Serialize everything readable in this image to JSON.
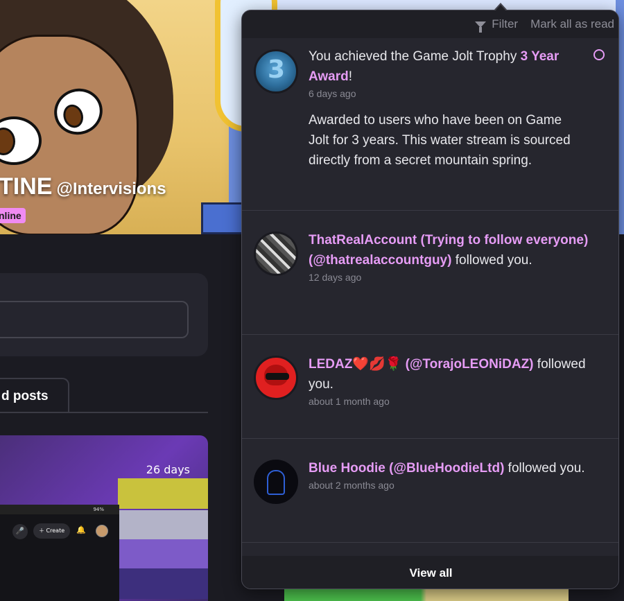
{
  "profile": {
    "name_fragment": "TINE",
    "handle": "@Intervisions",
    "status": "nline"
  },
  "page": {
    "tab_fragment": "d posts",
    "post_age": "26 days",
    "phone_status": "94%",
    "phone_create_label": "Create"
  },
  "popover": {
    "header": {
      "filter_label": "Filter",
      "mark_read_label": "Mark all as read"
    },
    "notifications": [
      {
        "prefix": "You achieved the Game Jolt Trophy ",
        "link": "3 Year Award",
        "suffix": "!",
        "time": "6 days ago",
        "description": "Awarded to users who have been on Game Jolt for 3 years. This water stream is sourced directly from a secret mountain spring.",
        "avatar_icon": "trophy-3-icon",
        "unread": true
      },
      {
        "link": "ThatRealAccount (Trying to follow everyone) (@thatrealaccountguy)",
        "suffix": " followed you.",
        "time": "12 days ago",
        "avatar_icon": "city-avatar"
      },
      {
        "link": "LEDAZ❤️💋🌹 (@TorajoLEONiDAZ)",
        "suffix": " followed you.",
        "time": "about 1 month ago",
        "avatar_icon": "ledaz-avatar"
      },
      {
        "link": "Blue Hoodie (@BlueHoodieLtd)",
        "suffix": " followed you.",
        "time": "about 2 months ago",
        "avatar_icon": "hoodie-avatar"
      }
    ],
    "footer_label": "View all"
  },
  "colors": {
    "accent": "#e69cf5",
    "popover_bg": "#26262e",
    "header_bg": "#1f1f25"
  }
}
